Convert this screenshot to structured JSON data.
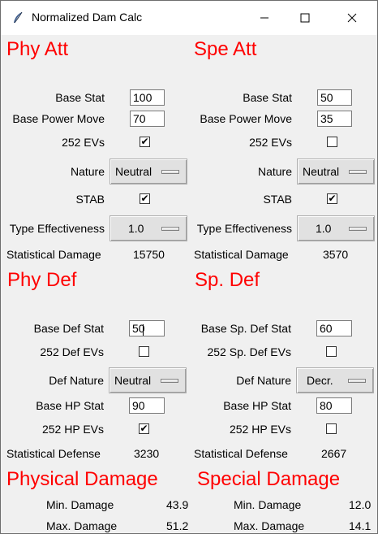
{
  "window": {
    "title": "Normalized Dam Calc"
  },
  "phy_att": {
    "header": "Phy Att",
    "base_stat_label": "Base Stat",
    "base_stat": "100",
    "base_power_label": "Base Power Move",
    "base_power": "70",
    "evs_label": "252 EVs",
    "evs_checked": true,
    "nature_label": "Nature",
    "nature": "Neutral",
    "stab_label": "STAB",
    "stab_checked": true,
    "type_eff_label": "Type Effectiveness",
    "type_eff": "1.0",
    "stat_damage_label": "Statistical Damage",
    "stat_damage": "15750"
  },
  "spe_att": {
    "header": "Spe Att",
    "base_stat_label": "Base Stat",
    "base_stat": "50",
    "base_power_label": "Base Power Move",
    "base_power": "35",
    "evs_label": "252 EVs",
    "evs_checked": false,
    "nature_label": "Nature",
    "nature": "Neutral",
    "stab_label": "STAB",
    "stab_checked": true,
    "type_eff_label": "Type Effectiveness",
    "type_eff": "1.0",
    "stat_damage_label": "Statistical Damage",
    "stat_damage": "3570"
  },
  "phy_def": {
    "header": "Phy Def",
    "base_def_label": "Base Def Stat",
    "base_def": "50",
    "def_evs_label": "252 Def EVs",
    "def_evs_checked": false,
    "def_nature_label": "Def Nature",
    "def_nature": "Neutral",
    "base_hp_label": "Base HP Stat",
    "base_hp": "90",
    "hp_evs_label": "252 HP EVs",
    "hp_evs_checked": true,
    "stat_defense_label": "Statistical Defense",
    "stat_defense": "3230"
  },
  "sp_def": {
    "header": "Sp. Def",
    "base_def_label": "Base Sp. Def Stat",
    "base_def": "60",
    "def_evs_label": "252 Sp. Def EVs",
    "def_evs_checked": false,
    "def_nature_label": "Def Nature",
    "def_nature": "Decr.",
    "base_hp_label": "Base HP Stat",
    "base_hp": "80",
    "hp_evs_label": "252 HP EVs",
    "hp_evs_checked": false,
    "stat_defense_label": "Statistical Defense",
    "stat_defense": "2667"
  },
  "physical_damage": {
    "header": "Physical Damage",
    "min_label": "Min. Damage",
    "min": "43.9",
    "max_label": "Max. Damage",
    "max": "51.2"
  },
  "special_damage": {
    "header": "Special Damage",
    "min_label": "Min. Damage",
    "min": "12.0",
    "max_label": "Max. Damage",
    "max": "14.1"
  },
  "colors": {
    "header": "#ff0000",
    "title_bg": "#ffffff",
    "window_bg": "#f0f0f0"
  },
  "icons": {
    "app": "feather-icon",
    "minimize": "minimize-icon",
    "maximize": "maximize-icon",
    "close": "close-icon"
  }
}
